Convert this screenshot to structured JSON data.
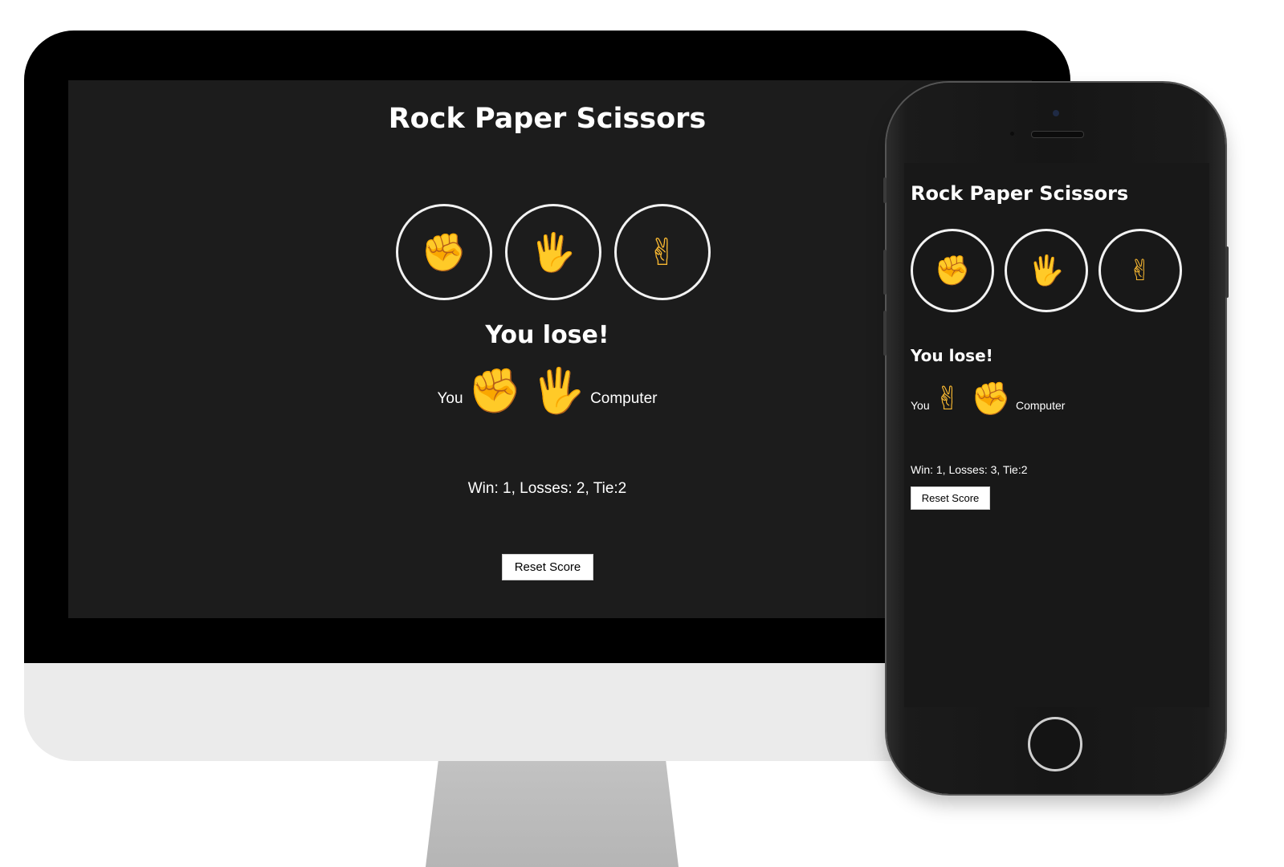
{
  "colors": {
    "app_background": "#1c1c1c",
    "text": "#ffffff",
    "emoji": "#f7b731",
    "button_background": "#ffffff"
  },
  "desktop": {
    "title": "Rock Paper Scissors",
    "choices": [
      {
        "icon": "raised-fist-icon",
        "glyph": "✊"
      },
      {
        "icon": "raised-hand-icon",
        "glyph": "🖐"
      },
      {
        "icon": "victory-hand-icon",
        "glyph": "✌"
      }
    ],
    "result": "You lose!",
    "you_label": "You",
    "computer_label": "Computer",
    "you_move": "✊",
    "computer_move": "🖐",
    "score": "Win: 1, Losses: 2, Tie:2",
    "reset_label": "Reset Score"
  },
  "mobile": {
    "title": "Rock Paper Scissors",
    "choices": [
      {
        "icon": "raised-fist-icon",
        "glyph": "✊"
      },
      {
        "icon": "raised-hand-icon",
        "glyph": "🖐"
      },
      {
        "icon": "victory-hand-icon",
        "glyph": "✌"
      }
    ],
    "result": "You lose!",
    "you_label": "You",
    "computer_label": "Computer",
    "you_move": "✌",
    "computer_move": "✊",
    "score": "Win: 1, Losses: 3, Tie:2",
    "reset_label": "Reset Score"
  }
}
